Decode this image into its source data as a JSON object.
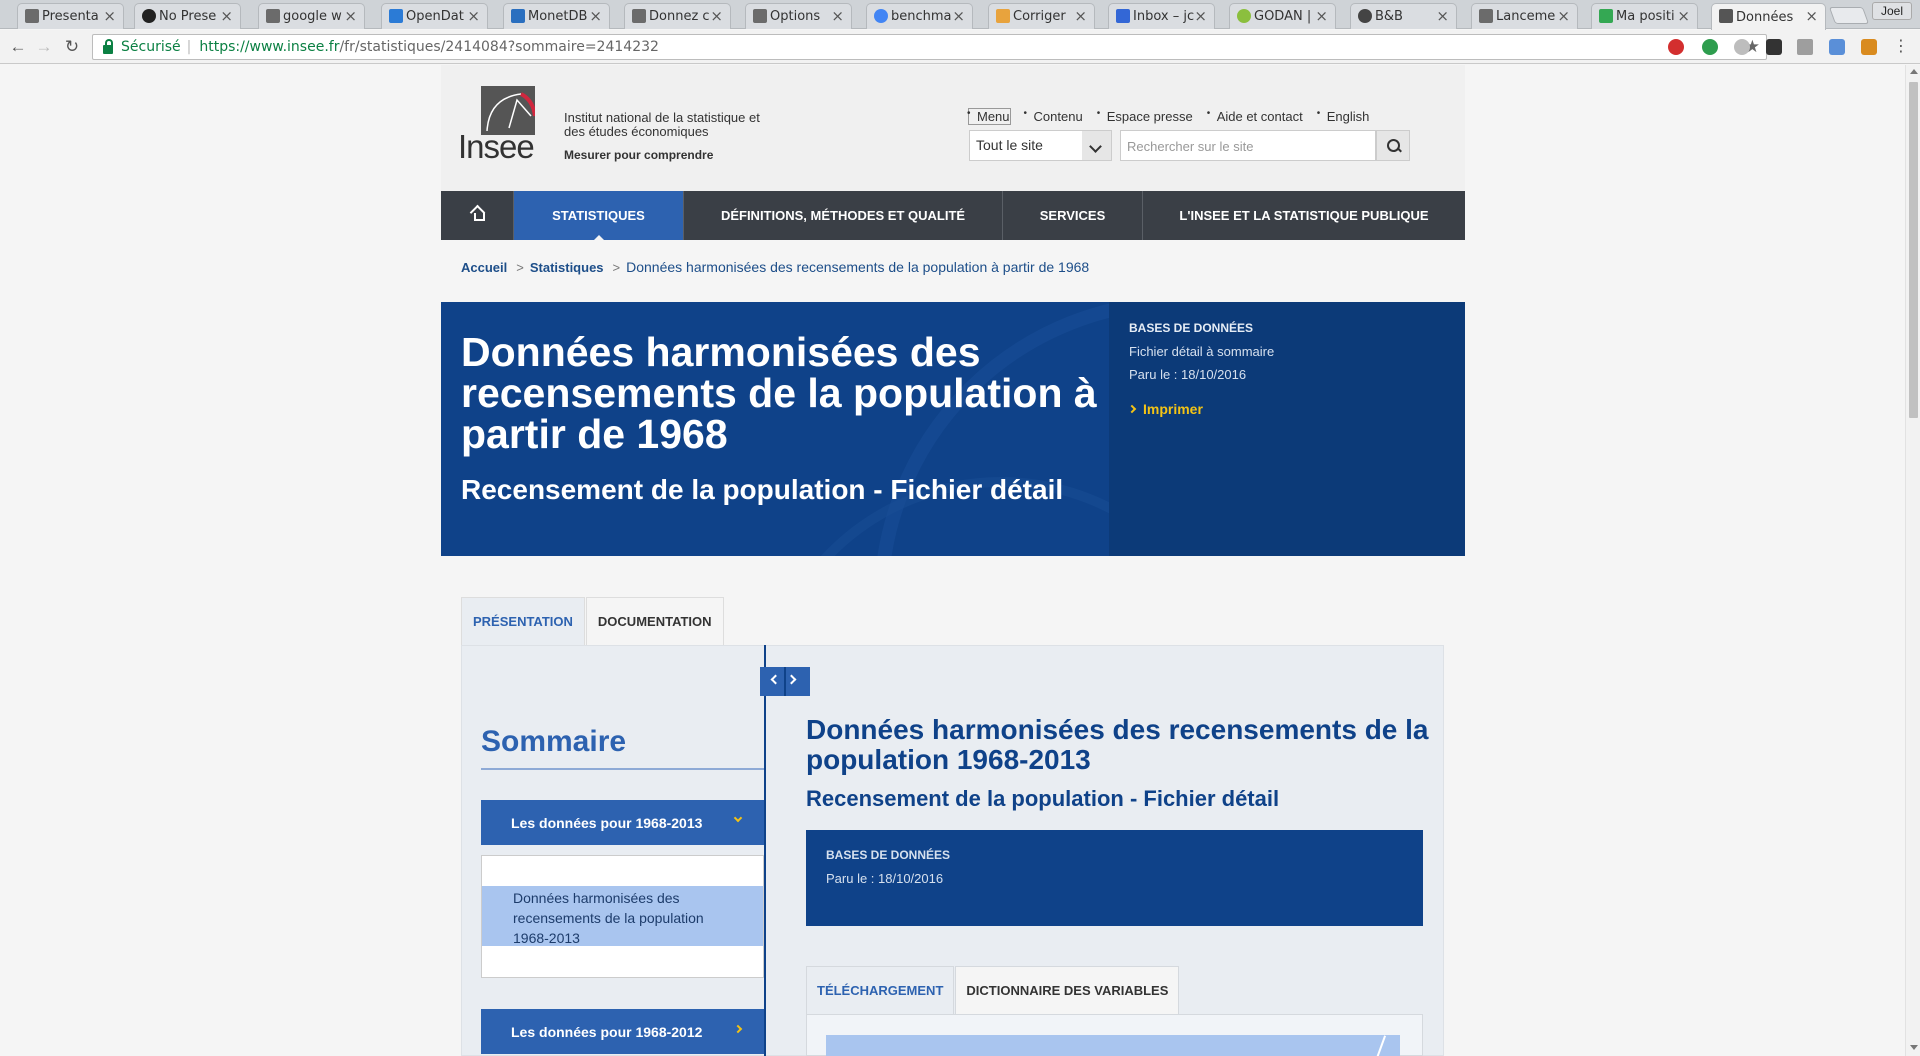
{
  "browser": {
    "tabs": [
      {
        "title": "Presenta",
        "fav": "#6b6b6b"
      },
      {
        "title": "No Prese",
        "fav": "#222222"
      },
      {
        "title": "google w",
        "fav": "#6b6b6b"
      },
      {
        "title": "OpenDat",
        "fav": "#2b7bd6"
      },
      {
        "title": "MonetDB",
        "fav": "#2a6fbf"
      },
      {
        "title": "Donnez c",
        "fav": "#6b6b6b"
      },
      {
        "title": "Options",
        "fav": "#6b6b6b"
      },
      {
        "title": "benchma",
        "fav": "#4285f4"
      },
      {
        "title": "Corriger",
        "fav": "#e8a33d"
      },
      {
        "title": "Inbox – jc",
        "fav": "#3367d6"
      },
      {
        "title": "GODAN |",
        "fav": "#8bbf3e"
      },
      {
        "title": "B&B",
        "fav": "#444444"
      },
      {
        "title": "Lanceme",
        "fav": "#6b6b6b"
      },
      {
        "title": "Ma positi",
        "fav": "#34a853"
      },
      {
        "title": "Données",
        "fav": "#555555"
      }
    ],
    "profile_name": "Joel",
    "secure_label": "Sécurisé",
    "url_host": "https://www.insee.fr",
    "url_path": "/fr/statistiques/2414084?sommaire=2414232",
    "star_icon": "★",
    "extensions": [
      "#d32f2f",
      "#2e9d4e",
      "#bdbdbd",
      "#333333",
      "#9e9e9e",
      "#5a8fd8",
      "#d98b1f",
      "#666666"
    ]
  },
  "header": {
    "logo_text": "Insee",
    "institution_name": "Institut national de la statistique et des études économiques",
    "motto": "Mesurer pour comprendre",
    "top_links": [
      "Menu",
      "Contenu",
      "Espace presse",
      "Aide et contact",
      "English"
    ],
    "scope_value": "Tout le site",
    "search_placeholder": "Rechercher sur le site"
  },
  "nav": {
    "items": [
      "STATISTIQUES",
      "DÉFINITIONS, MÉTHODES ET QUALITÉ",
      "SERVICES",
      "L'INSEE ET LA STATISTIQUE PUBLIQUE"
    ]
  },
  "breadcrumb": {
    "home": "Accueil",
    "section": "Statistiques",
    "current": "Données harmonisées des recensements de la population à partir de 1968"
  },
  "hero": {
    "title": "Données harmonisées des recensements de la population à partir de 1968",
    "subtitle": "Recensement de la population - Fichier détail",
    "category": "BASES DE DONNÉES",
    "type": "Fichier détail à sommaire",
    "date": "Paru le : 18/10/2016",
    "print": "Imprimer"
  },
  "page_tabs": [
    "PRÉSENTATION",
    "DOCUMENTATION"
  ],
  "sommaire": {
    "title": "Sommaire",
    "group1": "Les données pour 1968-2013",
    "group1_item": "Données harmonisées des recensements de la population 1968-2013",
    "group2": "Les données pour 1968-2012"
  },
  "document": {
    "title": "Données harmonisées des recensements de la population 1968-2013",
    "subtitle": "Recensement de la population - Fichier détail",
    "category": "BASES DE DONNÉES",
    "date": "Paru le : 18/10/2016",
    "tabs": [
      "TÉLÉCHARGEMENT",
      "DICTIONNAIRE DES VARIABLES"
    ]
  }
}
